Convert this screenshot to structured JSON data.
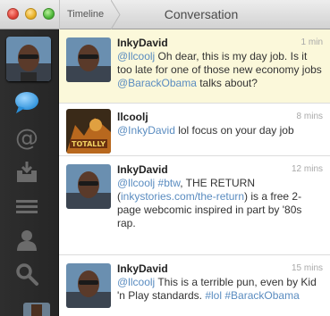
{
  "window": {
    "breadcrumb": "Timeline",
    "title": "Conversation"
  },
  "sidebar": {
    "icons": [
      "chat-bubble-icon",
      "at-icon",
      "inbox-icon",
      "list-icon",
      "person-icon",
      "search-icon"
    ]
  },
  "tweets": [
    {
      "user": "InkyDavid",
      "time": "1 min",
      "highlighted": true,
      "parts": [
        {
          "t": "mention",
          "v": "@llcoolj"
        },
        {
          "t": "text",
          "v": " Oh dear, this is my day job. Is it too late for one of those new economy jobs "
        },
        {
          "t": "mention",
          "v": "@BarackObama"
        },
        {
          "t": "text",
          "v": " talks about?"
        }
      ]
    },
    {
      "user": "llcoolj",
      "time": "8 mins",
      "highlighted": false,
      "parts": [
        {
          "t": "mention",
          "v": "@InkyDavid"
        },
        {
          "t": "text",
          "v": " lol focus on your day job"
        }
      ]
    },
    {
      "user": "InkyDavid",
      "time": "12 mins",
      "highlighted": false,
      "parts": [
        {
          "t": "mention",
          "v": "@llcoolj"
        },
        {
          "t": "text",
          "v": " "
        },
        {
          "t": "tag",
          "v": "#btw"
        },
        {
          "t": "text",
          "v": ", THE RETURN ("
        },
        {
          "t": "link",
          "v": "inkystories.com/the-return"
        },
        {
          "t": "text",
          "v": ") is a free 2-page webcomic inspired in part by '80s rap."
        }
      ]
    },
    {
      "user": "InkyDavid",
      "time": "15 mins",
      "highlighted": false,
      "parts": [
        {
          "t": "mention",
          "v": "@llcoolj"
        },
        {
          "t": "text",
          "v": " This is a terrible pun, even by Kid 'n Play standards. "
        },
        {
          "t": "tag",
          "v": "#lol"
        },
        {
          "t": "text",
          "v": " "
        },
        {
          "t": "tag",
          "v": "#BarackObama"
        }
      ]
    }
  ]
}
